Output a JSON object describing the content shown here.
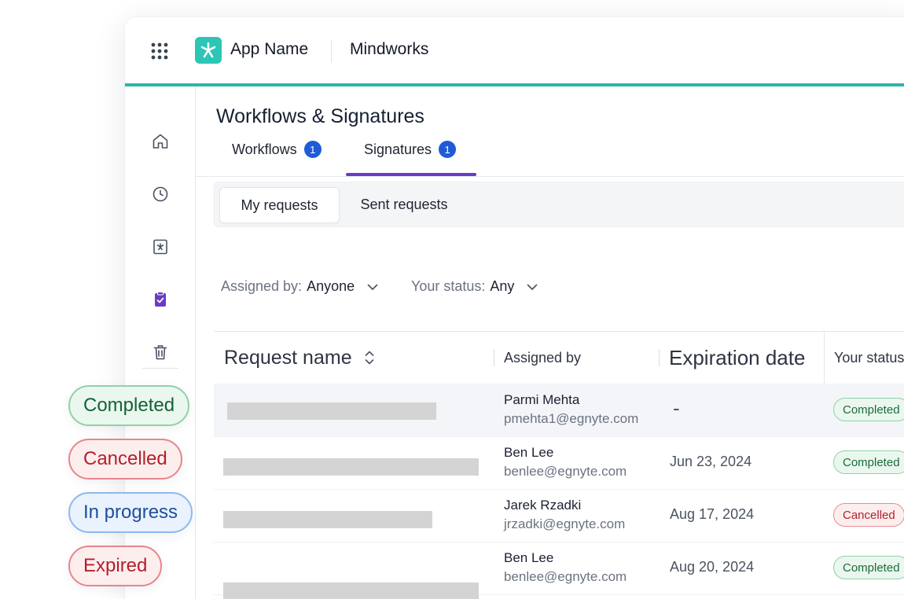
{
  "header": {
    "app_name": "App Name",
    "org_name": "Mindworks"
  },
  "page": {
    "title": "Workflows & Signatures",
    "tabs": [
      {
        "label": "Workflows",
        "badge": "1"
      },
      {
        "label": "Signatures",
        "badge": "1"
      }
    ],
    "active_tab": "Signatures"
  },
  "segments": {
    "items": [
      "My requests",
      "Sent requests"
    ],
    "active": "My requests"
  },
  "filters": [
    {
      "label": "Assigned by:",
      "value": "Anyone"
    },
    {
      "label": "Your status:",
      "value": "Any"
    }
  ],
  "table": {
    "columns": [
      "Request name",
      "Assigned by",
      "Expiration date",
      "Your status"
    ],
    "rows": [
      {
        "assignee_name": "Parmi Mehta",
        "assignee_email": "pmehta1@egnyte.com",
        "expiration": "-",
        "status": "Completed"
      },
      {
        "assignee_name": "Ben Lee",
        "assignee_email": "benlee@egnyte.com",
        "expiration": "Jun 23, 2024",
        "status": "Completed"
      },
      {
        "assignee_name": "Jarek Rzadki",
        "assignee_email": "jrzadki@egnyte.com",
        "expiration": "Aug 17, 2024",
        "status": "Cancelled"
      },
      {
        "assignee_name": "Ben Lee",
        "assignee_email": "benlee@egnyte.com",
        "expiration": "Aug 20, 2024",
        "status": "Completed"
      }
    ]
  },
  "status_legend": [
    "Completed",
    "Cancelled",
    "In progress",
    "Expired"
  ],
  "icons": {
    "apps": "grid-icon",
    "logo": "asterisk-logo-icon",
    "sidebar": [
      "home-icon",
      "clock-icon",
      "asterisk-document-icon",
      "clipboard-check-icon",
      "trash-icon"
    ]
  },
  "colors": {
    "accent": "#2bb6a8",
    "tab_active": "#6a3bc4",
    "badge": "#1f5bd6",
    "sidebar_active": "#6a3bc4"
  }
}
